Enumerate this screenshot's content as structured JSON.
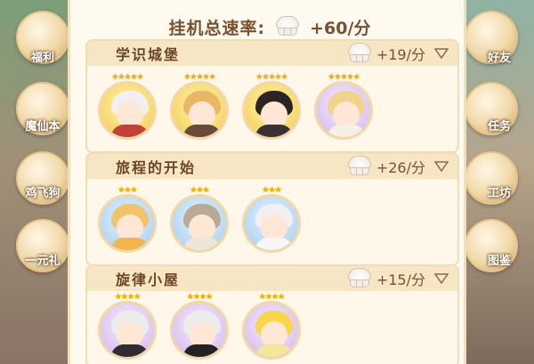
{
  "side_left": [
    {
      "label": "福利"
    },
    {
      "label": "魔仙本"
    },
    {
      "label": "鸡飞狗"
    },
    {
      "label": "一元礼"
    }
  ],
  "side_right": [
    {
      "label": "好友"
    },
    {
      "label": "任务"
    },
    {
      "label": "工坊"
    },
    {
      "label": "图鉴"
    }
  ],
  "total": {
    "label": "挂机总速率:",
    "value": "+60/分"
  },
  "sections": [
    {
      "title": "学识城堡",
      "rate": "+19/分",
      "characters": [
        {
          "stars": "★★★★★",
          "bg": "yellow",
          "hair": "#f3eef2",
          "outfit": "#c0423a"
        },
        {
          "stars": "★★★★★",
          "bg": "yellow",
          "hair": "#e9b765",
          "outfit": "#6b4a35"
        },
        {
          "stars": "★★★★★",
          "bg": "yellow",
          "hair": "#2b2524",
          "outfit": "#3a3232"
        },
        {
          "stars": "★★★★★",
          "bg": "purple",
          "hair": "#f2d38e",
          "outfit": "#f6f0e6"
        }
      ]
    },
    {
      "title": "旅程的开始",
      "rate": "+26/分",
      "characters": [
        {
          "stars": "★★★",
          "bg": "blue",
          "hair": "#f2c36b",
          "outfit": "#f1b44e"
        },
        {
          "stars": "★★★",
          "bg": "blue",
          "hair": "#b9a995",
          "outfit": "#efe6da"
        },
        {
          "stars": "★★★",
          "bg": "blue",
          "hair": "#f3f0ef",
          "outfit": "#f7f7f7"
        }
      ]
    },
    {
      "title": "旋律小屋",
      "rate": "+15/分",
      "characters": [
        {
          "stars": "★★★★",
          "bg": "purple",
          "hair": "#ececec",
          "outfit": "#2f2b33"
        },
        {
          "stars": "★★★★",
          "bg": "purple",
          "hair": "#ececec",
          "outfit": "#222222"
        },
        {
          "stars": "★★★★",
          "bg": "purple",
          "hair": "#f7d64a",
          "outfit": "#f2e79a"
        }
      ]
    }
  ]
}
